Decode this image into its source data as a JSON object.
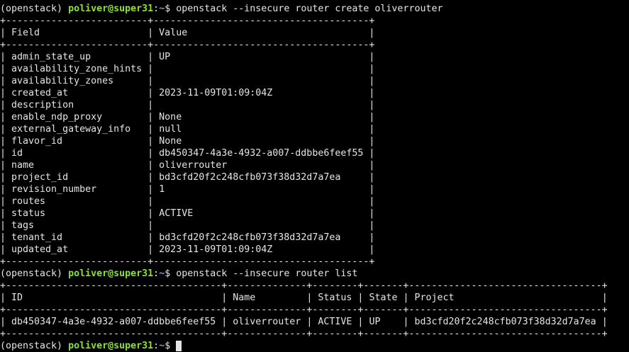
{
  "prompt": {
    "env": "(openstack) ",
    "user_host": "poliver@super31",
    "sep": ":",
    "path": "~",
    "symbol": "$ "
  },
  "commands": [
    "openstack --insecure router create oliverrouter",
    "openstack --insecure router list"
  ],
  "create_table": {
    "headers": [
      "Field",
      "Value"
    ],
    "rows": [
      [
        "admin_state_up",
        "UP"
      ],
      [
        "availability_zone_hints",
        ""
      ],
      [
        "availability_zones",
        ""
      ],
      [
        "created_at",
        "2023-11-09T01:09:04Z"
      ],
      [
        "description",
        ""
      ],
      [
        "enable_ndp_proxy",
        "None"
      ],
      [
        "external_gateway_info",
        "null"
      ],
      [
        "flavor_id",
        "None"
      ],
      [
        "id",
        "db450347-4a3e-4932-a007-ddbbe6feef55"
      ],
      [
        "name",
        "oliverrouter"
      ],
      [
        "project_id",
        "bd3cfd20f2c248cfb073f38d32d7a7ea"
      ],
      [
        "revision_number",
        "1"
      ],
      [
        "routes",
        ""
      ],
      [
        "status",
        "ACTIVE"
      ],
      [
        "tags",
        ""
      ],
      [
        "tenant_id",
        "bd3cfd20f2c248cfb073f38d32d7a7ea"
      ],
      [
        "updated_at",
        "2023-11-09T01:09:04Z"
      ]
    ]
  },
  "list_table": {
    "headers": [
      "ID",
      "Name",
      "Status",
      "State",
      "Project"
    ],
    "rows": [
      [
        "db450347-4a3e-4932-a007-ddbbe6feef55",
        "oliverrouter",
        "ACTIVE",
        "UP",
        "bd3cfd20f2c248cfb073f38d32d7a7ea"
      ]
    ]
  }
}
